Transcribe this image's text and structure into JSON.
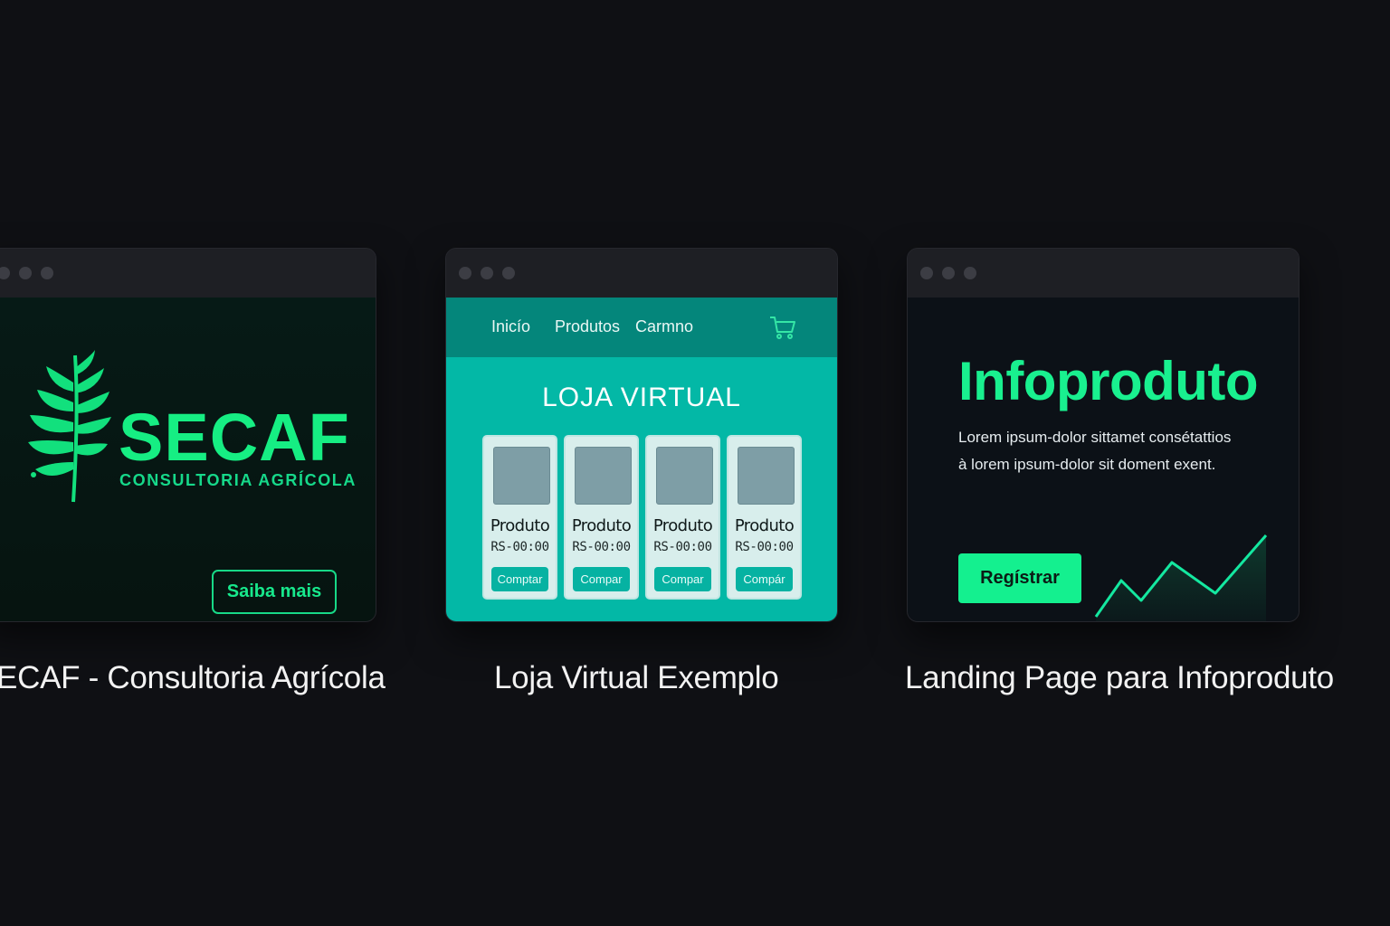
{
  "portfolio": [
    {
      "id": "secaf",
      "brand_title": "SECAF",
      "brand_subtitle": "CONSULTORIA AGRÍCOLA",
      "cta_label": "Saiba mais",
      "caption": "SECAF - Consultoria Agrícola",
      "accent": "#16ee83",
      "icon": "leaf-icon"
    },
    {
      "id": "loja",
      "nav": [
        "Inicío",
        "Produtos",
        "Carmno"
      ],
      "cart_icon": "cart-icon",
      "shop_title": "LOJA VIRTUAL",
      "products": [
        {
          "name": "Produto",
          "price": "RS-00:00",
          "button": "Comptar"
        },
        {
          "name": "Produto",
          "price": "RS-00:00",
          "button": "Compar"
        },
        {
          "name": "Produto",
          "price": "RS-00:00",
          "button": "Compar"
        },
        {
          "name": "Produto",
          "price": "RS-00:00",
          "button": "Compár"
        }
      ],
      "caption": "Loja Virtual Exemplo",
      "accent": "#03b8a6"
    },
    {
      "id": "info",
      "title": "Infoproduto",
      "text_line1": "Lorem ipsum-dolor sittamet consétattios",
      "text_line2": "à lorem ipsum-dolor sit doment exent.",
      "cta_label": "Regístrar",
      "growth_icon": "growth-chart-icon",
      "caption": "Landing Page para Infoproduto",
      "accent": "#14f08f"
    }
  ]
}
